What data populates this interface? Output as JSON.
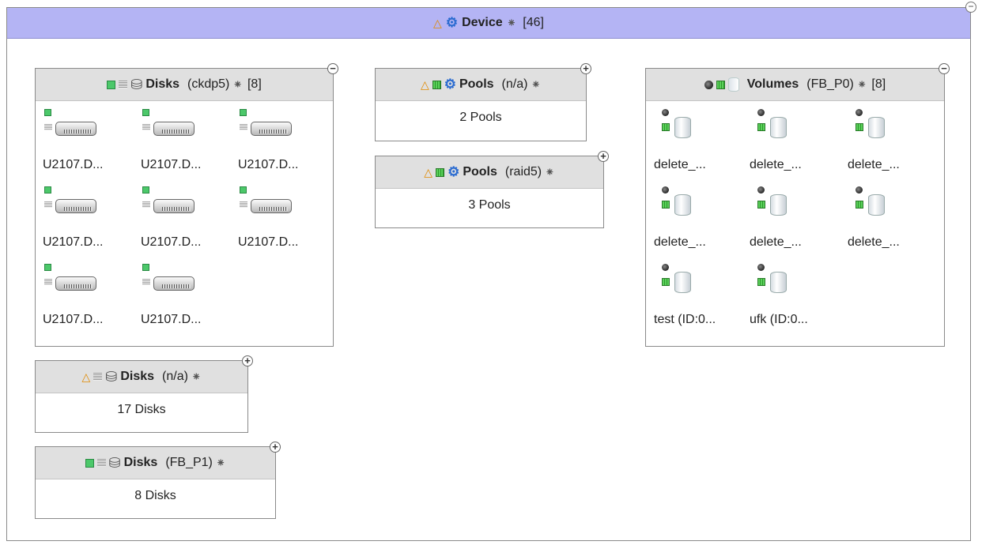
{
  "device": {
    "title": "Device",
    "count": "[46]",
    "collapse_glyph": "−"
  },
  "icons": {
    "warning": "△",
    "star": "⁕",
    "gears": "⚙",
    "disks": "⛁",
    "plus": "+",
    "minus": "−"
  },
  "groups": {
    "disks_ckdp5": {
      "title": "Disks",
      "sub": "(ckdp5)",
      "count": "[8]",
      "items": [
        "U2107.D...",
        "U2107.D...",
        "U2107.D...",
        "U2107.D...",
        "U2107.D...",
        "U2107.D...",
        "U2107.D...",
        "U2107.D..."
      ]
    },
    "pools_na": {
      "title": "Pools",
      "sub": "(n/a)",
      "summary": "2 Pools"
    },
    "pools_raid5": {
      "title": "Pools",
      "sub": "(raid5)",
      "summary": "3 Pools"
    },
    "volumes_fbp0": {
      "title": "Volumes",
      "sub": "(FB_P0)",
      "count": "[8]",
      "items": [
        "delete_...",
        "delete_...",
        "delete_...",
        "delete_...",
        "delete_...",
        "delete_...",
        "test (ID:0...",
        "ufk (ID:0..."
      ]
    },
    "disks_na": {
      "title": "Disks",
      "sub": "(n/a)",
      "summary": "17 Disks"
    },
    "disks_fbp1": {
      "title": "Disks",
      "sub": "(FB_P1)",
      "summary": "8 Disks"
    }
  }
}
